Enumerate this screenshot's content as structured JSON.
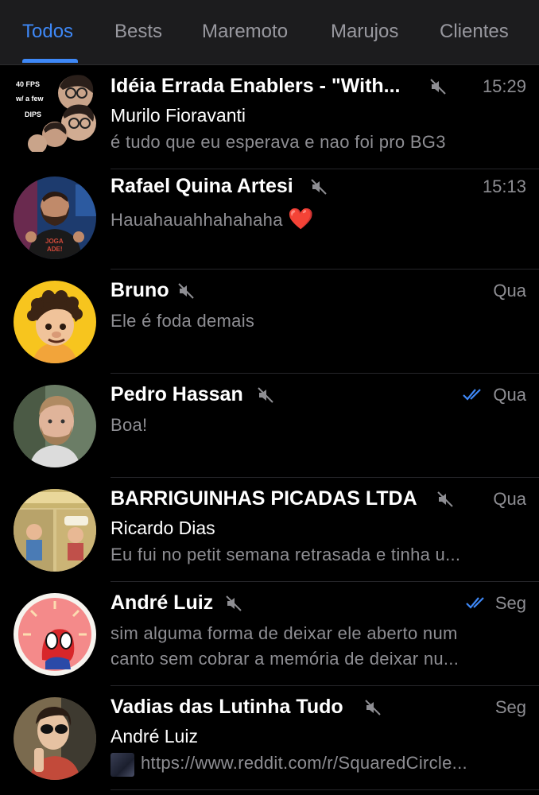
{
  "tabs": [
    {
      "label": "Todos",
      "active": true
    },
    {
      "label": "Bests",
      "active": false
    },
    {
      "label": "Maremoto",
      "active": false
    },
    {
      "label": "Marujos",
      "active": false
    },
    {
      "label": "Clientes",
      "active": false
    }
  ],
  "chats": [
    {
      "name": "Idéia Errada Enablers - \"With...",
      "time": "15:29",
      "sender": "Murilo Fioravanti",
      "message": "é tudo que eu esperava e nao foi pro BG3",
      "avatar_text": [
        "40 FPS",
        "w/ a few",
        "DIPS"
      ]
    },
    {
      "name": "Rafael Quina Artesi",
      "time": "15:13",
      "message": "Hauahauahhahahaha",
      "emoji": "❤️"
    },
    {
      "name": "Bruno",
      "time": "Qua",
      "message": "Ele é foda demais"
    },
    {
      "name": "Pedro Hassan",
      "time": "Qua",
      "message": "Boa!",
      "read": true
    },
    {
      "name": "BARRIGUINHAS PICADAS LTDA",
      "time": "Qua",
      "sender": "Ricardo Dias",
      "message": "Eu fui no petit semana retrasada e tinha u..."
    },
    {
      "name": "André Luiz",
      "time": "Seg",
      "read": true,
      "message_line1": "sim alguma forma de deixar ele aberto num",
      "message_line2": "canto sem cobrar a memória de deixar nu..."
    },
    {
      "name": "Vadias das Lutinha Tudo",
      "time": "Seg",
      "sender": "André Luiz",
      "message": "https://www.reddit.com/r/SquaredCircle..."
    }
  ],
  "colors": {
    "accent": "#3e88f7",
    "secondary_text": "#8e8e93",
    "background": "#000000"
  }
}
